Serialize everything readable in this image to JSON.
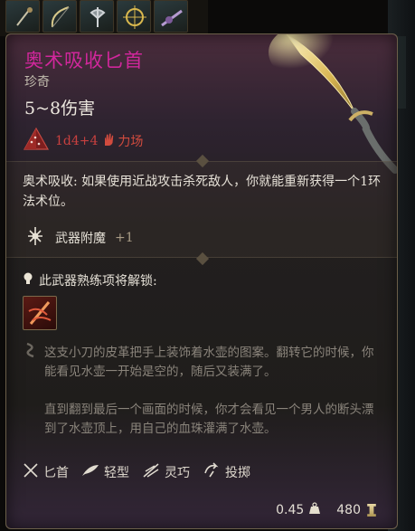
{
  "item": {
    "name": "奥术吸收匕首",
    "rarity": "珍奇",
    "damage": "5~8伤害",
    "damage_dice": "1d4+4",
    "damage_stat": "力场"
  },
  "passive": {
    "text": "奥术吸收: 如果使用近战攻击杀死敌人，你就能重新获得一个1环法术位。"
  },
  "enchant": {
    "label": "武器附魔",
    "value": "+1"
  },
  "proficiency": {
    "title": "此武器熟练项将解锁:"
  },
  "flavor": {
    "p1": "这支小刀的皮革把手上装饰着水壶的图案。翻转它的时候，你能看见水壶一开始是空的，随后又装满了。",
    "p2": "直到翻到最后一个画面的时候，你才会看见一个男人的断头漂到了水壶顶上，用自己的血珠灌满了水壶。"
  },
  "properties": [
    "匕首",
    "轻型",
    "灵巧",
    "投掷"
  ],
  "weight": "0.45",
  "value": "480",
  "colors": {
    "name": "#d0279b",
    "force": "#d14b3e"
  }
}
